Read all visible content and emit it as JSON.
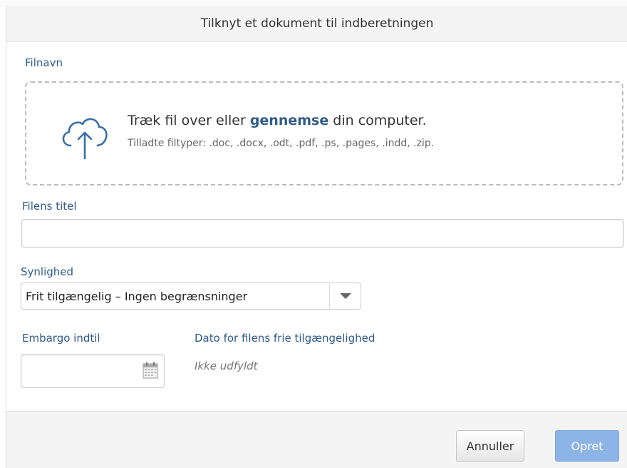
{
  "dialog": {
    "title": "Tilknyt et dokument til indberetningen"
  },
  "upload": {
    "label": "Filnavn",
    "main_before": "Træk fil over eller ",
    "browse_link": "gennemse",
    "main_after": " din computer.",
    "allowed_types": "Tilladte filtyper: .doc, .docx, .odt, .pdf, .ps, .pages, .indd, .zip.",
    "icon": "cloud-upload-icon"
  },
  "file_title": {
    "label": "Filens titel",
    "value": ""
  },
  "visibility": {
    "label": "Synlighed",
    "selected": "Frit tilgængelig – Ingen begrænsninger"
  },
  "embargo": {
    "label": "Embargo indtil",
    "value": "",
    "icon": "calendar-icon",
    "availability_label": "Dato for filens frie tilgængelighed",
    "availability_value": "Ikke udfyldt"
  },
  "footer": {
    "cancel_label": "Annuller",
    "create_label": "Opret"
  },
  "colors": {
    "label_blue": "#2f5b8a",
    "primary_button": "#8cb4e6"
  }
}
